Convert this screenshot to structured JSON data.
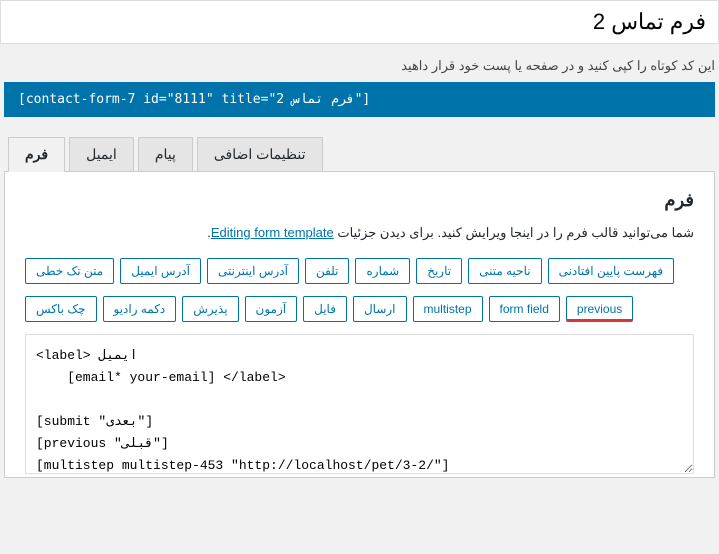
{
  "title": "فرم تماس 2",
  "subtitle": "این کد کوتاه را کپی کنید و در صفحه یا پست خود قرار داهید",
  "shortcode": "[contact-form-7 id=\"8111\" title=\"فرم تماس 2\"]",
  "tabs": [
    {
      "label": "فرم",
      "active": true
    },
    {
      "label": "ایمیل",
      "active": false
    },
    {
      "label": "پیام",
      "active": false
    },
    {
      "label": "تنظیمات اضافی",
      "active": false
    }
  ],
  "panel": {
    "heading": "فرم",
    "desc_prefix": "شما می‌توانید قالب فرم را در اینجا ویرایش کنید. برای دیدن جزئیات ",
    "desc_link": "Editing form template",
    "desc_suffix": "."
  },
  "tag_buttons_row1": [
    "متن تک خطی",
    "آدرس ایمیل",
    "آدرس اینترنتی",
    "تلفن",
    "شماره",
    "تاریخ",
    "ناحیه متنی",
    "فهرست پایین افتادنی"
  ],
  "tag_buttons_row2": [
    "چک باکس",
    "دکمه رادیو",
    "پذیرش",
    "آزمون",
    "فایل",
    "ارسال",
    "multistep",
    "form field",
    "previous"
  ],
  "highlighted_button": "previous",
  "form_code": "<label> ایمیل\n    [email* your-email] </label>\n\n[submit \"بعدی\"]\n[previous \"قبلی\"]\n[multistep multistep-453 \"http://localhost/pet/3-2/\"]"
}
